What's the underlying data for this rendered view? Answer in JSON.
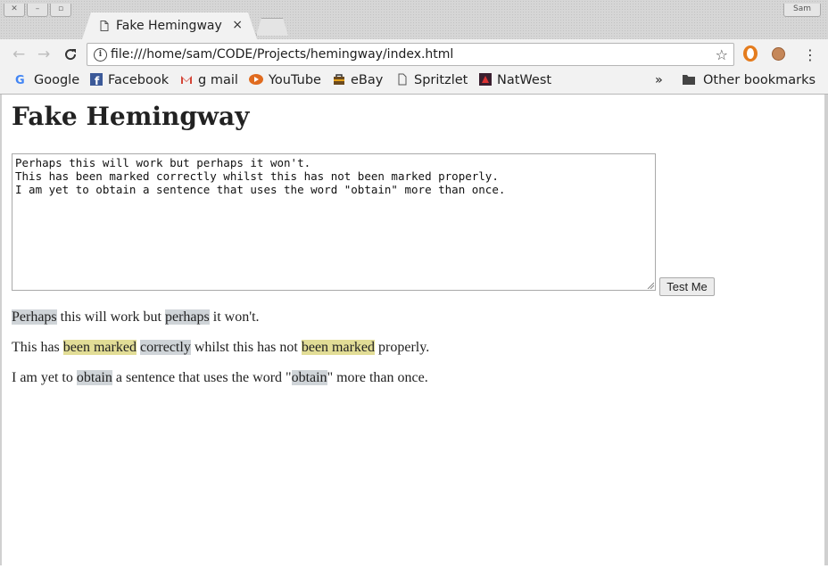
{
  "window": {
    "profile_label": "Sam"
  },
  "tab": {
    "title": "Fake Hemingway",
    "close_glyph": "×"
  },
  "toolbar": {
    "back": "←",
    "forward": "→",
    "reload": "C",
    "url": "file:///home/sam/CODE/Projects/hemingway/index.html",
    "star": "☆",
    "menu": "⋮"
  },
  "bookmarks": {
    "items": [
      "Google",
      "Facebook",
      "g mail",
      "YouTube",
      "eBay",
      "Spritzlet",
      "NatWest"
    ],
    "overflow": "»",
    "other": "Other bookmarks"
  },
  "page": {
    "title": "Fake Hemingway",
    "editor_text": "Perhaps this will work but perhaps it won't.\nThis has been marked correctly whilst this has not been marked properly.\nI am yet to obtain a sentence that uses the word \"obtain\" more than once.",
    "button_label": "Test Me",
    "output": [
      [
        {
          "t": "Perhaps",
          "h": "adverb"
        },
        {
          "t": " this will work but "
        },
        {
          "t": "perhaps",
          "h": "adverb"
        },
        {
          "t": " it won't."
        }
      ],
      [
        {
          "t": "This has "
        },
        {
          "t": "been marked",
          "h": "passive"
        },
        {
          "t": " "
        },
        {
          "t": "correctly",
          "h": "adverb"
        },
        {
          "t": " whilst this has not "
        },
        {
          "t": "been marked",
          "h": "passive"
        },
        {
          "t": " properly."
        }
      ],
      [
        {
          "t": "I am yet to "
        },
        {
          "t": "obtain",
          "h": "adverb"
        },
        {
          "t": " a sentence that uses the word \""
        },
        {
          "t": "obtain",
          "h": "adverb"
        },
        {
          "t": "\" more than once."
        }
      ]
    ]
  },
  "colors": {
    "highlight_adverb": "#cfd4d8",
    "highlight_passive": "#e2dd96"
  }
}
